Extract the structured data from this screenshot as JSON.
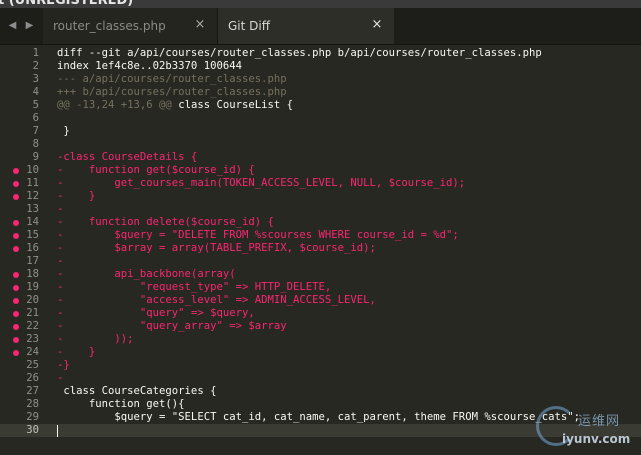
{
  "window": {
    "title": "t (UNREGISTERED)"
  },
  "tabs": [
    {
      "label": "router_classes.php",
      "close": "×",
      "active": false
    },
    {
      "label": "Git Diff",
      "close": "×",
      "active": true
    }
  ],
  "nav": {
    "back_icon": "triangle-left-icon",
    "forward_icon": "triangle-right-icon"
  },
  "editor": {
    "syntax_colors": {
      "background": "#272822",
      "removed": "#f92672",
      "comment": "#75715e",
      "text": "#f8f8f2",
      "marker": "#f92672"
    },
    "current_line": 30,
    "lines": [
      {
        "n": "1",
        "type": "header",
        "marker": false,
        "text": "diff --git a/api/courses/router_classes.php b/api/courses/router_classes.php"
      },
      {
        "n": "2",
        "type": "header",
        "marker": false,
        "text": "index 1ef4c8e..02b3370 100644"
      },
      {
        "n": "3",
        "type": "comment",
        "marker": false,
        "text": "--- a/api/courses/router_classes.php"
      },
      {
        "n": "4",
        "type": "comment",
        "marker": false,
        "text": "+++ b/api/courses/router_classes.php"
      },
      {
        "n": "5",
        "type": "hunk",
        "marker": false,
        "hunk": "@@ -13,24 +13,6 @@",
        "text": " class CourseList {"
      },
      {
        "n": "6",
        "type": "context",
        "marker": false,
        "text": ""
      },
      {
        "n": "7",
        "type": "context",
        "marker": false,
        "text": " }"
      },
      {
        "n": "8",
        "type": "context",
        "marker": false,
        "text": ""
      },
      {
        "n": "9",
        "type": "removed",
        "marker": false,
        "text": "-class CourseDetails {"
      },
      {
        "n": "10",
        "type": "removed",
        "marker": true,
        "text": "-    function get($course_id) {"
      },
      {
        "n": "11",
        "type": "removed",
        "marker": true,
        "text": "-        get_courses_main(TOKEN_ACCESS_LEVEL, NULL, $course_id);"
      },
      {
        "n": "12",
        "type": "removed",
        "marker": true,
        "text": "-    }"
      },
      {
        "n": "13",
        "type": "removed",
        "marker": false,
        "text": "-"
      },
      {
        "n": "14",
        "type": "removed",
        "marker": true,
        "text": "-    function delete($course_id) {"
      },
      {
        "n": "15",
        "type": "removed",
        "marker": true,
        "text": "-        $query = \"DELETE FROM %scourses WHERE course_id = %d\";"
      },
      {
        "n": "16",
        "type": "removed",
        "marker": true,
        "text": "-        $array = array(TABLE_PREFIX, $course_id);"
      },
      {
        "n": "17",
        "type": "removed",
        "marker": false,
        "text": "-"
      },
      {
        "n": "18",
        "type": "removed",
        "marker": true,
        "text": "-        api_backbone(array("
      },
      {
        "n": "19",
        "type": "removed",
        "marker": true,
        "text": "-            \"request_type\" => HTTP_DELETE,"
      },
      {
        "n": "20",
        "type": "removed",
        "marker": true,
        "text": "-            \"access_level\" => ADMIN_ACCESS_LEVEL,"
      },
      {
        "n": "21",
        "type": "removed",
        "marker": true,
        "text": "-            \"query\" => $query,"
      },
      {
        "n": "22",
        "type": "removed",
        "marker": true,
        "text": "-            \"query_array\" => $array"
      },
      {
        "n": "23",
        "type": "removed",
        "marker": true,
        "text": "-        ));"
      },
      {
        "n": "24",
        "type": "removed",
        "marker": true,
        "text": "-    }"
      },
      {
        "n": "25",
        "type": "removed",
        "marker": false,
        "text": "-}"
      },
      {
        "n": "26",
        "type": "removed",
        "marker": false,
        "text": "-"
      },
      {
        "n": "27",
        "type": "context",
        "marker": false,
        "text": " class CourseCategories {"
      },
      {
        "n": "28",
        "type": "context",
        "marker": false,
        "text": "     function get(){"
      },
      {
        "n": "29",
        "type": "context",
        "marker": false,
        "text": "         $query = \"SELECT cat_id, cat_name, cat_parent, theme FROM %scourse_cats\";"
      },
      {
        "n": "30",
        "type": "context",
        "marker": false,
        "text": ""
      }
    ]
  },
  "watermark": {
    "cn": "运维网",
    "url": "iyunv.com"
  }
}
